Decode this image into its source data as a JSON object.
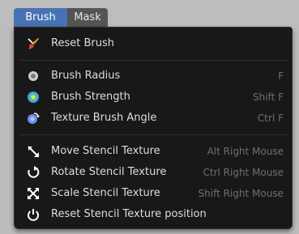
{
  "tabs": [
    {
      "label": "Brush",
      "active": true
    },
    {
      "label": "Mask",
      "active": false
    }
  ],
  "menu": {
    "groups": [
      [
        {
          "label": "Reset Brush",
          "shortcut": "",
          "icon": "reset-brush-icon"
        }
      ],
      [
        {
          "label": "Brush Radius",
          "shortcut": "F",
          "icon": "brush-radius-icon"
        },
        {
          "label": "Brush Strength",
          "shortcut": "Shift F",
          "icon": "brush-strength-icon"
        },
        {
          "label": "Texture Brush Angle",
          "shortcut": "Ctrl F",
          "icon": "texture-brush-angle-icon"
        }
      ],
      [
        {
          "label": "Move Stencil Texture",
          "shortcut": "Alt Right Mouse",
          "icon": "move-stencil-icon"
        },
        {
          "label": "Rotate Stencil Texture",
          "shortcut": "Ctrl Right Mouse",
          "icon": "rotate-stencil-icon"
        },
        {
          "label": "Scale Stencil Texture",
          "shortcut": "Shift Right Mouse",
          "icon": "scale-stencil-icon"
        },
        {
          "label": "Reset Stencil Texture position",
          "shortcut": "",
          "icon": "power-icon"
        }
      ]
    ]
  },
  "colors": {
    "accent": "#4772b3",
    "menu_bg": "#181818",
    "text": "#dddddd",
    "shortcut": "#6f6f6f"
  }
}
